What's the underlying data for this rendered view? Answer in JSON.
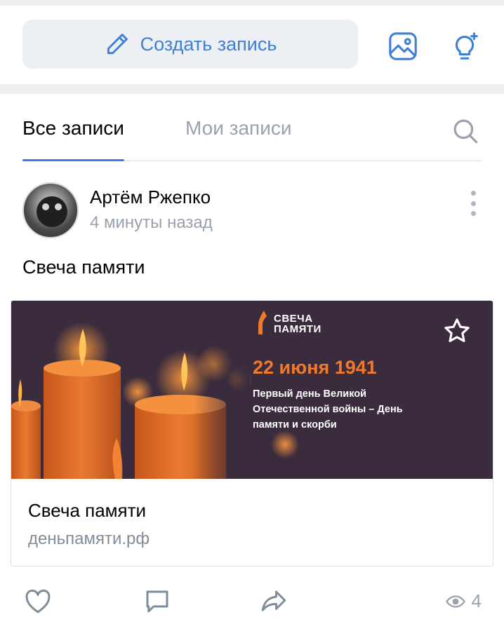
{
  "composer": {
    "create_label": "Создать запись"
  },
  "tabs": {
    "all": "Все записи",
    "mine": "Мои записи"
  },
  "post": {
    "author": "Артём Ржепко",
    "timestamp": "4 минуты назад",
    "text": "Свеча памяти",
    "link": {
      "banner": {
        "logo_line1": "СВЕЧА",
        "logo_line2": "ПАМЯТИ",
        "date": "22 июня 1941",
        "description": "Первый день Великой Отечественной войны – День памяти и скорби"
      },
      "title": "Свеча памяти",
      "domain": "деньпамяти.рф"
    },
    "views": "4"
  },
  "colors": {
    "accent": "#3f7fd4",
    "muted": "#99a2ad",
    "banner_bg": "#3a2c3d",
    "banner_orange": "#f07a2a"
  },
  "icons": [
    "pencil-icon",
    "photo-icon",
    "idea-bulb-icon",
    "search-icon",
    "more-vertical-icon",
    "star-icon",
    "heart-icon",
    "comment-icon",
    "share-icon",
    "eye-icon"
  ]
}
